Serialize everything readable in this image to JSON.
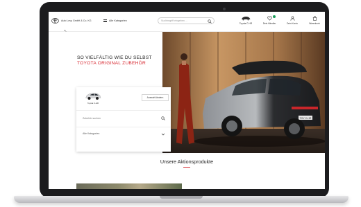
{
  "header": {
    "dealer_name": "Auto Levy GmbH & Co. KG",
    "categories_label": "Alle Kategorien",
    "search_placeholder": "Suchbegriff eingeben ...",
    "icons": [
      {
        "name": "car-icon",
        "label": "Toyota C-HR"
      },
      {
        "name": "heart-icon",
        "label": "Dein Händler"
      },
      {
        "name": "user-icon",
        "label": "Dein Konto"
      },
      {
        "name": "cart-icon",
        "label": "Warenkorb"
      }
    ]
  },
  "hero": {
    "line1": "SO VIELFÄLTIG WIE DU SELBST",
    "line2": "TOYOTA ORIGINAL ZUBEHÖR",
    "image_plate": "TOY C-HR"
  },
  "selector": {
    "car_name": "Toyota C-HR",
    "change_label": "Auswahl ändern",
    "search_placeholder": "Zubehör suchen",
    "categories_label": "Alle Kategorien"
  },
  "promotions": {
    "title": "Unsere Aktionsprodukte"
  },
  "colors": {
    "accent_red": "#d7272f",
    "frame": "#1c1c1e",
    "status_green": "#1a9e5a"
  }
}
